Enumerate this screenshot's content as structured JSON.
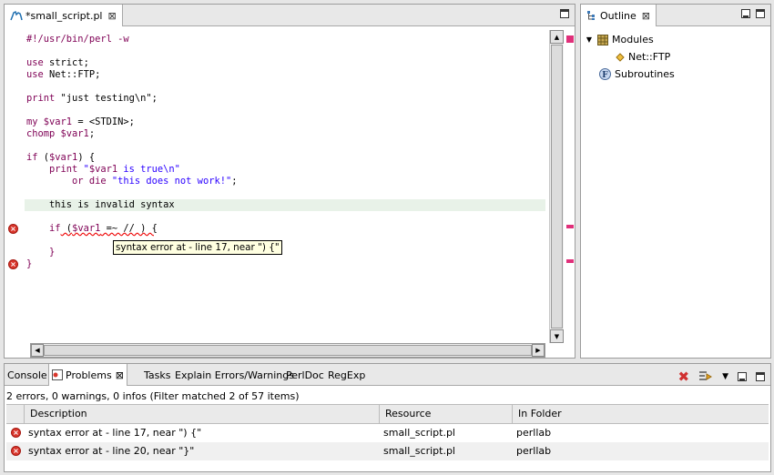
{
  "editor": {
    "tab_title": "*small_script.pl",
    "code_lines": [
      {
        "parts": [
          {
            "t": "#!/usr/bin/perl -w",
            "c": "kw"
          }
        ]
      },
      {
        "parts": []
      },
      {
        "parts": [
          {
            "t": "use",
            "c": "kw"
          },
          {
            "t": " strict;",
            "c": "op"
          }
        ]
      },
      {
        "parts": [
          {
            "t": "use",
            "c": "kw"
          },
          {
            "t": " Net::FTP;",
            "c": "op"
          }
        ]
      },
      {
        "parts": []
      },
      {
        "parts": [
          {
            "t": "print",
            "c": "kw"
          },
          {
            "t": " ",
            "c": "op"
          },
          {
            "t": "\"just testing\\n\"",
            "c": "op"
          },
          {
            "t": ";",
            "c": "op"
          }
        ]
      },
      {
        "parts": []
      },
      {
        "parts": [
          {
            "t": "my",
            "c": "kw"
          },
          {
            "t": " $var1",
            "c": "var"
          },
          {
            "t": " = <STDIN>;",
            "c": "op"
          }
        ]
      },
      {
        "parts": [
          {
            "t": "chomp",
            "c": "kw"
          },
          {
            "t": " $var1",
            "c": "var"
          },
          {
            "t": ";",
            "c": "op"
          }
        ]
      },
      {
        "parts": []
      },
      {
        "parts": [
          {
            "t": "if",
            "c": "kw"
          },
          {
            "t": " (",
            "c": "op"
          },
          {
            "t": "$var1",
            "c": "var"
          },
          {
            "t": ") {",
            "c": "op"
          }
        ]
      },
      {
        "parts": [
          {
            "t": "    print",
            "c": "kw"
          },
          {
            "t": " ",
            "c": "op"
          },
          {
            "t": "\"",
            "c": "str"
          },
          {
            "t": "$var1",
            "c": "var"
          },
          {
            "t": " is true\\n\"",
            "c": "str"
          }
        ]
      },
      {
        "parts": [
          {
            "t": "        or",
            "c": "kw"
          },
          {
            "t": " die",
            "c": "kw"
          },
          {
            "t": " \"this does not work!\"",
            "c": "str"
          },
          {
            "t": ";",
            "c": "op"
          }
        ]
      },
      {
        "parts": []
      },
      {
        "parts": [
          {
            "t": "    this is invalid syntax",
            "c": "op"
          }
        ],
        "highlight": true
      },
      {
        "parts": []
      },
      {
        "parts": [
          {
            "t": "    if",
            "c": "kw"
          },
          {
            "t": " (",
            "c": "op"
          },
          {
            "t": "$var1",
            "c": "var"
          },
          {
            "t": " =~ // ) {",
            "c": "op"
          }
        ],
        "error": true
      },
      {
        "parts": []
      },
      {
        "parts": [
          {
            "t": "    }",
            "c": "kw"
          }
        ]
      },
      {
        "parts": [
          {
            "t": "}",
            "c": "kw"
          }
        ],
        "error": true
      }
    ],
    "tooltip": "syntax error at - line 17, near \") {\""
  },
  "outline": {
    "tab_title": "Outline",
    "modules_label": "Modules",
    "module_item": "Net::FTP",
    "subroutines_label": "Subroutines"
  },
  "problems": {
    "tabs": [
      {
        "label": "Console"
      },
      {
        "label": "Problems",
        "active": true
      },
      {
        "label": "Tasks"
      },
      {
        "label": "Explain Errors/Warnings"
      },
      {
        "label": "PerlDoc"
      },
      {
        "label": "RegExp"
      }
    ],
    "summary": "2 errors, 0 warnings, 0 infos (Filter matched 2 of 57 items)",
    "columns": [
      "Description",
      "Resource",
      "In Folder"
    ],
    "rows": [
      {
        "description": "syntax error at - line 17, near \") {\"",
        "resource": "small_script.pl",
        "folder": "perllab"
      },
      {
        "description": "syntax error at - line 20, near \"}\"",
        "resource": "small_script.pl",
        "folder": "perllab"
      }
    ]
  }
}
